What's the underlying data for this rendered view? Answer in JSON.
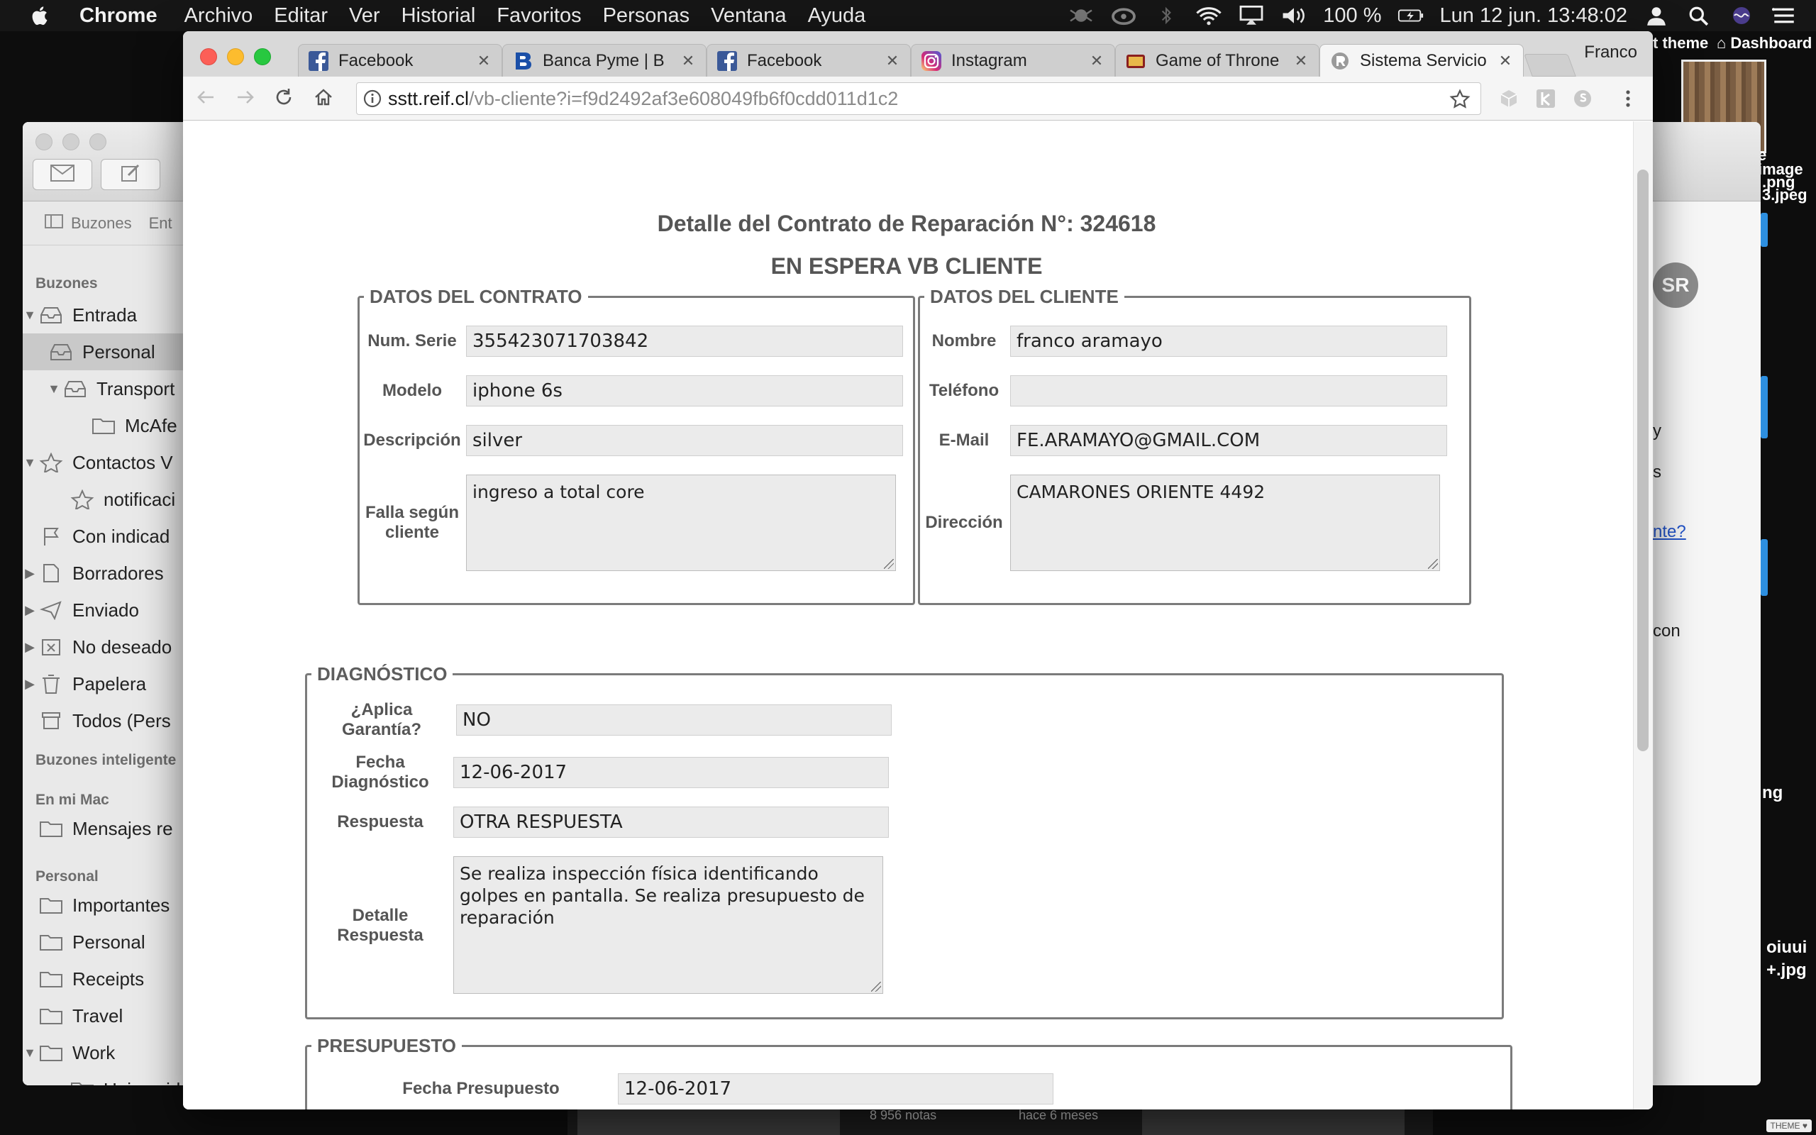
{
  "menubar": {
    "app": "Chrome",
    "menus": [
      "Archivo",
      "Editar",
      "Ver",
      "Historial",
      "Favoritos",
      "Personas",
      "Ventana",
      "Ayuda"
    ],
    "battery": "100 %",
    "clock": "Lun 12 jun.  13:48:02"
  },
  "desktop": {
    "theme_label": "t theme",
    "dashboard_label": "Dashboard",
    "file_labels": [
      "e",
      "image",
      ".png",
      "3.jpeg"
    ],
    "bottom_labels": [
      "oiuui",
      "+.jpg"
    ],
    "notes_count": "8 956 notas",
    "notes_time": "hace 6 meses",
    "theme_badge": "THEME ♥"
  },
  "mail": {
    "toolbar_mailboxes": "Buzones",
    "toolbar_entrada": "Ent",
    "sections": {
      "buzones": "Buzones",
      "smart": "Buzones inteligente",
      "on_mac": "En mi Mac",
      "personal": "Personal"
    },
    "items": {
      "entrada": "Entrada",
      "personal": "Personal",
      "transport": "Transport",
      "mcafee": "McAfe",
      "contactos": "Contactos V",
      "notificaciones": "notificaci",
      "con_indicador": "Con indicad",
      "borradores": "Borradores",
      "enviado": "Enviado",
      "no_deseado": "No deseado",
      "papelera": "Papelera",
      "todos": "Todos (Pers",
      "mensajes": "Mensajes re",
      "importantes": "Importantes",
      "personal2": "Personal",
      "receipts": "Receipts",
      "travel": "Travel",
      "work": "Work",
      "universidad": "Universid"
    },
    "avatar_initials": "SR",
    "strip": {
      "t1": "y",
      "t2": "s",
      "link": "nte?",
      "t3": "con",
      "t4": "ng"
    }
  },
  "browser": {
    "profile": "Franco",
    "tabs": [
      {
        "title": "Facebook",
        "icon": "facebook-icon"
      },
      {
        "title": "Banca Pyme | B",
        "icon": "bank-icon"
      },
      {
        "title": "Facebook",
        "icon": "facebook-icon"
      },
      {
        "title": "Instagram",
        "icon": "instagram-icon"
      },
      {
        "title": "Game of Throne",
        "icon": "tv-icon"
      },
      {
        "title": "Sistema Servicio",
        "icon": "sistema-icon"
      }
    ],
    "url_host": "sstt.reif.cl",
    "url_path": "/vb-cliente?i=f9d2492af3e608049fb6f0cdd011d1c2"
  },
  "page": {
    "title": "Detalle del Contrato de Reparación N°: 324618",
    "status": "EN ESPERA VB CLIENTE",
    "contrato": {
      "legend": "DATOS DEL CONTRATO",
      "serie_label": "Num. Serie",
      "serie": "355423071703842",
      "modelo_label": "Modelo",
      "modelo": "iphone 6s",
      "descripcion_label": "Descripción",
      "descripcion": "silver",
      "falla_label": "Falla según cliente",
      "falla": "ingreso a total core"
    },
    "cliente": {
      "legend": "DATOS DEL CLIENTE",
      "nombre_label": "Nombre",
      "nombre": "franco aramayo",
      "telefono_label": "Teléfono",
      "telefono": "",
      "email_label": "E-Mail",
      "email": "FE.ARAMAYO@GMAIL.COM",
      "direccion_label": "Dirección",
      "direccion": "CAMARONES ORIENTE 4492"
    },
    "diagnostico": {
      "legend": "DIAGNÓSTICO",
      "garantia_label": "¿Aplica Garantía?",
      "garantia": "NO",
      "fecha_label": "Fecha Diagnóstico",
      "fecha": "12-06-2017",
      "respuesta_label": "Respuesta",
      "respuesta": "OTRA RESPUESTA",
      "detalle_label": "Detalle Respuesta",
      "detalle": "Se realiza inspección física identificando golpes en pantalla. Se realiza presupuesto de reparación"
    },
    "presupuesto": {
      "legend": "PRESUPUESTO",
      "fecha_label": "Fecha Presupuesto",
      "fecha": "12-06-2017"
    }
  }
}
